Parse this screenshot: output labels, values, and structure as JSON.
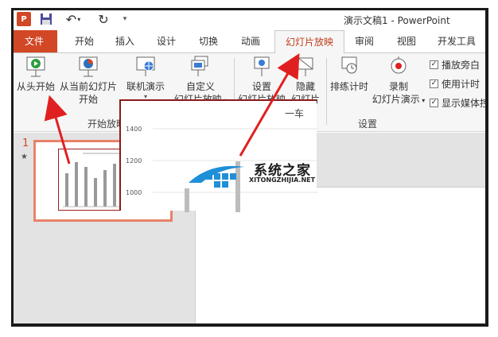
{
  "window": {
    "title": "演示文稿1 - PowerPoint",
    "app_logo_text": "P"
  },
  "tabs": [
    {
      "label": "文件"
    },
    {
      "label": "开始"
    },
    {
      "label": "插入"
    },
    {
      "label": "设计"
    },
    {
      "label": "切换"
    },
    {
      "label": "动画"
    },
    {
      "label": "幻灯片放映",
      "active": true
    },
    {
      "label": "审阅"
    },
    {
      "label": "视图"
    },
    {
      "label": "开发工具"
    }
  ],
  "ribbon": {
    "from_beginning": "从头开始",
    "from_current_line1": "从当前幻灯片",
    "from_current_line2": "开始",
    "present_online": "联机演示",
    "custom_line1": "自定义",
    "custom_line2": "幻灯片放映",
    "group_start": "开始放映幻灯片",
    "setup_line1": "设置",
    "setup_line2": "幻灯片放映",
    "hide_line1": "隐藏",
    "hide_line2": "幻灯片",
    "rehearse": "排练计时",
    "record_line1": "录制",
    "record_line2": "幻灯片演示",
    "group_setup": "设置",
    "check_narration": "播放旁白",
    "check_timings": "使用计时",
    "check_media": "显示媒体控"
  },
  "slides": {
    "number": "1",
    "star": "★"
  },
  "chart_data": {
    "type": "bar",
    "title": "一车",
    "yticks": [
      "1400",
      "1200",
      "1000"
    ],
    "ylim": [
      1000,
      1400
    ]
  },
  "watermark": {
    "name": "系统之家",
    "url": "XITONGZHIJIA.NET"
  },
  "colors": {
    "accent": "#d24726",
    "active_tab_text": "#c43e1c",
    "arrow": "#e02020"
  }
}
